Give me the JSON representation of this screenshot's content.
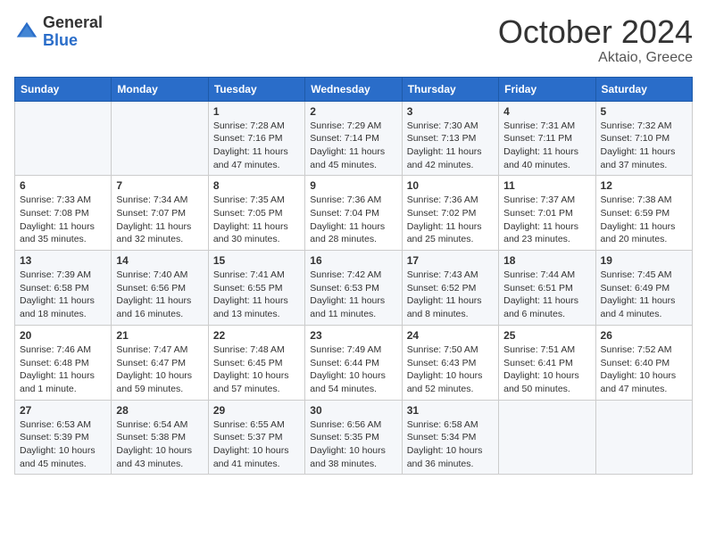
{
  "header": {
    "logo_general": "General",
    "logo_blue": "Blue",
    "month_title": "October 2024",
    "subtitle": "Aktaio, Greece"
  },
  "days_of_week": [
    "Sunday",
    "Monday",
    "Tuesday",
    "Wednesday",
    "Thursday",
    "Friday",
    "Saturday"
  ],
  "weeks": [
    [
      {
        "day": "",
        "info": ""
      },
      {
        "day": "",
        "info": ""
      },
      {
        "day": "1",
        "info": "Sunrise: 7:28 AM\nSunset: 7:16 PM\nDaylight: 11 hours and 47 minutes."
      },
      {
        "day": "2",
        "info": "Sunrise: 7:29 AM\nSunset: 7:14 PM\nDaylight: 11 hours and 45 minutes."
      },
      {
        "day": "3",
        "info": "Sunrise: 7:30 AM\nSunset: 7:13 PM\nDaylight: 11 hours and 42 minutes."
      },
      {
        "day": "4",
        "info": "Sunrise: 7:31 AM\nSunset: 7:11 PM\nDaylight: 11 hours and 40 minutes."
      },
      {
        "day": "5",
        "info": "Sunrise: 7:32 AM\nSunset: 7:10 PM\nDaylight: 11 hours and 37 minutes."
      }
    ],
    [
      {
        "day": "6",
        "info": "Sunrise: 7:33 AM\nSunset: 7:08 PM\nDaylight: 11 hours and 35 minutes."
      },
      {
        "day": "7",
        "info": "Sunrise: 7:34 AM\nSunset: 7:07 PM\nDaylight: 11 hours and 32 minutes."
      },
      {
        "day": "8",
        "info": "Sunrise: 7:35 AM\nSunset: 7:05 PM\nDaylight: 11 hours and 30 minutes."
      },
      {
        "day": "9",
        "info": "Sunrise: 7:36 AM\nSunset: 7:04 PM\nDaylight: 11 hours and 28 minutes."
      },
      {
        "day": "10",
        "info": "Sunrise: 7:36 AM\nSunset: 7:02 PM\nDaylight: 11 hours and 25 minutes."
      },
      {
        "day": "11",
        "info": "Sunrise: 7:37 AM\nSunset: 7:01 PM\nDaylight: 11 hours and 23 minutes."
      },
      {
        "day": "12",
        "info": "Sunrise: 7:38 AM\nSunset: 6:59 PM\nDaylight: 11 hours and 20 minutes."
      }
    ],
    [
      {
        "day": "13",
        "info": "Sunrise: 7:39 AM\nSunset: 6:58 PM\nDaylight: 11 hours and 18 minutes."
      },
      {
        "day": "14",
        "info": "Sunrise: 7:40 AM\nSunset: 6:56 PM\nDaylight: 11 hours and 16 minutes."
      },
      {
        "day": "15",
        "info": "Sunrise: 7:41 AM\nSunset: 6:55 PM\nDaylight: 11 hours and 13 minutes."
      },
      {
        "day": "16",
        "info": "Sunrise: 7:42 AM\nSunset: 6:53 PM\nDaylight: 11 hours and 11 minutes."
      },
      {
        "day": "17",
        "info": "Sunrise: 7:43 AM\nSunset: 6:52 PM\nDaylight: 11 hours and 8 minutes."
      },
      {
        "day": "18",
        "info": "Sunrise: 7:44 AM\nSunset: 6:51 PM\nDaylight: 11 hours and 6 minutes."
      },
      {
        "day": "19",
        "info": "Sunrise: 7:45 AM\nSunset: 6:49 PM\nDaylight: 11 hours and 4 minutes."
      }
    ],
    [
      {
        "day": "20",
        "info": "Sunrise: 7:46 AM\nSunset: 6:48 PM\nDaylight: 11 hours and 1 minute."
      },
      {
        "day": "21",
        "info": "Sunrise: 7:47 AM\nSunset: 6:47 PM\nDaylight: 10 hours and 59 minutes."
      },
      {
        "day": "22",
        "info": "Sunrise: 7:48 AM\nSunset: 6:45 PM\nDaylight: 10 hours and 57 minutes."
      },
      {
        "day": "23",
        "info": "Sunrise: 7:49 AM\nSunset: 6:44 PM\nDaylight: 10 hours and 54 minutes."
      },
      {
        "day": "24",
        "info": "Sunrise: 7:50 AM\nSunset: 6:43 PM\nDaylight: 10 hours and 52 minutes."
      },
      {
        "day": "25",
        "info": "Sunrise: 7:51 AM\nSunset: 6:41 PM\nDaylight: 10 hours and 50 minutes."
      },
      {
        "day": "26",
        "info": "Sunrise: 7:52 AM\nSunset: 6:40 PM\nDaylight: 10 hours and 47 minutes."
      }
    ],
    [
      {
        "day": "27",
        "info": "Sunrise: 6:53 AM\nSunset: 5:39 PM\nDaylight: 10 hours and 45 minutes."
      },
      {
        "day": "28",
        "info": "Sunrise: 6:54 AM\nSunset: 5:38 PM\nDaylight: 10 hours and 43 minutes."
      },
      {
        "day": "29",
        "info": "Sunrise: 6:55 AM\nSunset: 5:37 PM\nDaylight: 10 hours and 41 minutes."
      },
      {
        "day": "30",
        "info": "Sunrise: 6:56 AM\nSunset: 5:35 PM\nDaylight: 10 hours and 38 minutes."
      },
      {
        "day": "31",
        "info": "Sunrise: 6:58 AM\nSunset: 5:34 PM\nDaylight: 10 hours and 36 minutes."
      },
      {
        "day": "",
        "info": ""
      },
      {
        "day": "",
        "info": ""
      }
    ]
  ]
}
